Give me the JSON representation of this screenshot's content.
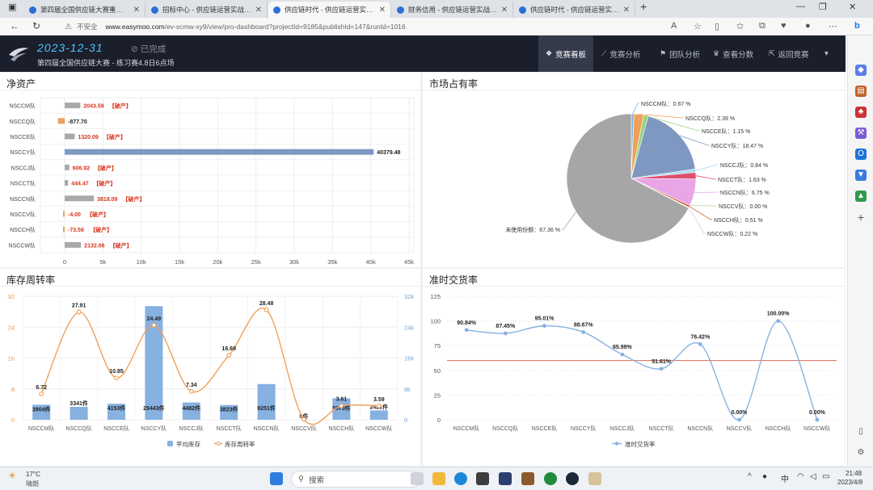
{
  "browser": {
    "tabs": [
      {
        "title": "第四届全国供应链大赛重庆电力"
      },
      {
        "title": "招标中心 - 供应链运营实战（赛"
      },
      {
        "title": "供应链时代 - 供应链运营实战（赛"
      },
      {
        "title": "财务信用 - 供应链运营实战（赛"
      },
      {
        "title": "供应链时代 - 供应链运营实战（赛"
      }
    ],
    "new_tab": "+",
    "security": "不安全",
    "url_host": "www.easymoo.com",
    "url_path": "/ev-scmw-xy9/view/pro-dashboard?projectId=9185&publishId=147&runId=1016"
  },
  "header": {
    "date": "2023-12-31",
    "status": "已完成",
    "subtitle": "第四届全国供应链大赛 - 练习赛4.8日6点场",
    "nav": [
      "竞赛看板",
      "竞赛分析",
      "团队分析",
      "查看分数",
      "返回竞赛"
    ]
  },
  "panels": {
    "net_assets": "净资产",
    "market_share": "市场占有率",
    "inventory": "库存周转率",
    "ontime": "准时交货率"
  },
  "chart_data": [
    {
      "type": "bar",
      "title": "净资产",
      "categories": [
        "NSCCM队",
        "NSCCQ队",
        "NSCCE队",
        "NSCCY队",
        "NSCCJ队",
        "NSCCT队",
        "NSCCN队",
        "NSCCV队",
        "NSCCH队",
        "NSCCW队"
      ],
      "values": [
        2043.59,
        -877.7,
        1320.09,
        40379.48,
        606.92,
        444.47,
        3818.09,
        -4.0,
        -73.56,
        2132.06
      ],
      "labels": [
        "2043.59",
        "-877.70",
        "1320.09",
        "40379.48",
        "606.92",
        "444.47",
        "3818.09",
        "-4.00",
        "-73.56",
        "2132.06"
      ],
      "bankrupt": [
        true,
        false,
        true,
        false,
        true,
        true,
        true,
        true,
        true,
        true
      ],
      "bankrupt_label": "【破产】",
      "xticks": [
        "0",
        "5k",
        "10k",
        "15k",
        "20k",
        "25k",
        "30k",
        "35k",
        "40k",
        "45k"
      ],
      "xlim": [
        -1000,
        45000
      ]
    },
    {
      "type": "pie",
      "title": "市场占有率",
      "labels": [
        "NSCCM队",
        "NSCCQ队",
        "NSCCE队",
        "NSCCY队",
        "NSCCJ队",
        "NSCCT队",
        "NSCCN队",
        "NSCCV队",
        "NSCCH队",
        "NSCCW队",
        "未使用份额"
      ],
      "values": [
        0.67,
        2.39,
        1.15,
        18.47,
        0.84,
        1.63,
        6.75,
        0.0,
        0.51,
        0.22,
        67.36
      ],
      "value_labels": [
        "0.67 %",
        "2.39 %",
        "1.15 %",
        "18.47 %",
        "0.84 %",
        "1.63 %",
        "6.75 %",
        "0.00 %",
        "0.51 %",
        "0.22 %",
        "67.36 %"
      ],
      "colors": [
        "#7fb3e0",
        "#f0a05a",
        "#9ad27a",
        "#7e98c2",
        "#a9dcf0",
        "#e0506e",
        "#e8a6e6",
        "#b5d59c",
        "#d55a3d",
        "#c7d9f0",
        "#a6a6a6"
      ]
    },
    {
      "type": "bar+line",
      "title": "库存周转率",
      "categories": [
        "NSCCM队",
        "NSCCQ队",
        "NSCCE队",
        "NSCCY队",
        "NSCCJ队",
        "NSCCT队",
        "NSCCN队",
        "NSCCV队",
        "NSCCH队",
        "NSCCW队"
      ],
      "series": [
        {
          "name": "平均库存",
          "values": [
            3904,
            3341,
            4153,
            29443,
            4482,
            3823,
            9251,
            0,
            5575,
            2421
          ],
          "labels": [
            "3904件",
            "3341件",
            "4153件",
            "29443件",
            "4482件",
            "3823件",
            "9251件",
            "0件",
            "5575件",
            "2421件"
          ]
        },
        {
          "name": "库存周转率",
          "values": [
            6.72,
            27.91,
            10.85,
            24.49,
            7.34,
            16.69,
            28.48,
            0.1,
            3.61,
            3.59
          ],
          "labels": [
            "6.72",
            "27.91",
            "10.85",
            "24.49",
            "7.34",
            "16.69",
            "28.48",
            "",
            "3.61",
            "3.59"
          ]
        }
      ],
      "yleft": {
        "ticks": [
          "0",
          "8",
          "16",
          "24",
          "32"
        ],
        "lim": [
          0,
          32
        ]
      },
      "yright": {
        "ticks": [
          "0",
          "8k",
          "16k",
          "24k",
          "32k"
        ],
        "lim": [
          0,
          32000
        ]
      }
    },
    {
      "type": "line",
      "title": "准时交货率",
      "categories": [
        "NSCCM队",
        "NSCCQ队",
        "NSCCE队",
        "NSCCY队",
        "NSCCJ队",
        "NSCCT队",
        "NSCCN队",
        "NSCCV队",
        "NSCCH队",
        "NSCCW队"
      ],
      "series": [
        {
          "name": "准时交货率",
          "values": [
            90.84,
            87.45,
            95.01,
            88.67,
            65.99,
            51.61,
            76.42,
            0.0,
            100.0,
            0.0
          ],
          "labels": [
            "90.84%",
            "87.45%",
            "95.01%",
            "88.67%",
            "65.99%",
            "51.61%",
            "76.42%",
            "0.00%",
            "100.00%",
            "0.00%"
          ]
        }
      ],
      "reference_line": 60,
      "yticks": [
        "0",
        "25",
        "50",
        "75",
        "100",
        "125"
      ],
      "ylim": [
        0,
        125
      ]
    }
  ],
  "taskbar": {
    "weather_temp": "17°C",
    "weather_desc": "晴朗",
    "search": "搜索",
    "ime": "中",
    "time": "21:48",
    "date": "2023/4/8"
  }
}
